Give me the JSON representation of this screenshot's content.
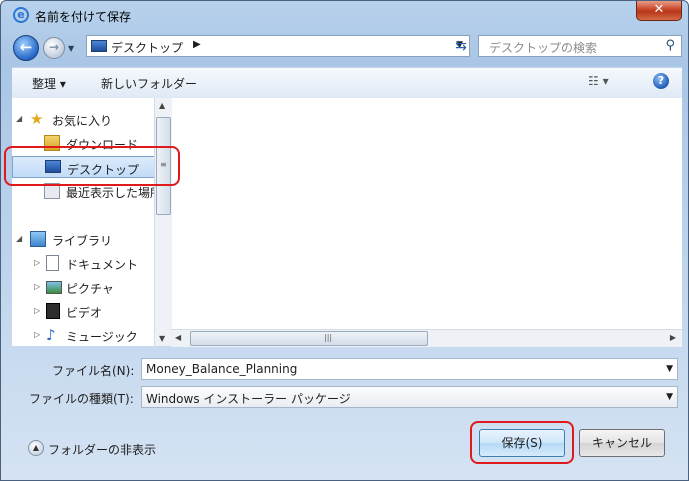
{
  "window": {
    "title": "名前を付けて保存",
    "close_label": "✕"
  },
  "nav": {
    "address": "デスクトップ",
    "search_placeholder": "デスクトップの検索"
  },
  "toolbar": {
    "organize": "整理 ▾",
    "new_folder": "新しいフォルダー"
  },
  "sidebar": {
    "items": [
      {
        "label": "お気に入り",
        "icon": "star-icon"
      },
      {
        "label": "ダウンロード",
        "icon": "download-folder-icon"
      },
      {
        "label": "デスクトップ",
        "icon": "desktop-icon",
        "selected": true
      },
      {
        "label": "最近表示した場所",
        "icon": "recent-places-icon"
      },
      {
        "label": "ライブラリ",
        "icon": "library-icon"
      },
      {
        "label": "ドキュメント",
        "icon": "documents-icon"
      },
      {
        "label": "ピクチャ",
        "icon": "pictures-icon"
      },
      {
        "label": "ビデオ",
        "icon": "videos-icon"
      },
      {
        "label": "ミュージック",
        "icon": "music-icon"
      }
    ]
  },
  "form": {
    "filename_label": "ファイル名(N):",
    "filename_value": "Money_Balance_Planning",
    "filetype_label": "ファイルの種類(T):",
    "filetype_value": "Windows インストーラー パッケージ"
  },
  "footer": {
    "hide_folders": "フォルダーの非表示",
    "save": "保存(S)",
    "cancel": "キャンセル"
  },
  "colors": {
    "highlight_ring": "#e0191b",
    "selection": "#c1dcf8"
  }
}
